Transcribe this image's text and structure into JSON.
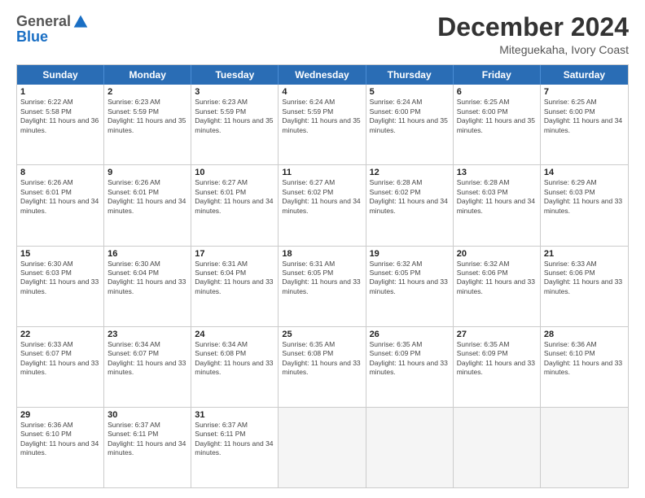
{
  "logo": {
    "general": "General",
    "blue": "Blue"
  },
  "header": {
    "month": "December 2024",
    "location": "Miteguekaha, Ivory Coast"
  },
  "days": [
    "Sunday",
    "Monday",
    "Tuesday",
    "Wednesday",
    "Thursday",
    "Friday",
    "Saturday"
  ],
  "weeks": [
    [
      {
        "day": "1",
        "sunrise": "6:22 AM",
        "sunset": "5:58 PM",
        "daylight": "11 hours and 36 minutes."
      },
      {
        "day": "2",
        "sunrise": "6:23 AM",
        "sunset": "5:59 PM",
        "daylight": "11 hours and 35 minutes."
      },
      {
        "day": "3",
        "sunrise": "6:23 AM",
        "sunset": "5:59 PM",
        "daylight": "11 hours and 35 minutes."
      },
      {
        "day": "4",
        "sunrise": "6:24 AM",
        "sunset": "5:59 PM",
        "daylight": "11 hours and 35 minutes."
      },
      {
        "day": "5",
        "sunrise": "6:24 AM",
        "sunset": "6:00 PM",
        "daylight": "11 hours and 35 minutes."
      },
      {
        "day": "6",
        "sunrise": "6:25 AM",
        "sunset": "6:00 PM",
        "daylight": "11 hours and 35 minutes."
      },
      {
        "day": "7",
        "sunrise": "6:25 AM",
        "sunset": "6:00 PM",
        "daylight": "11 hours and 34 minutes."
      }
    ],
    [
      {
        "day": "8",
        "sunrise": "6:26 AM",
        "sunset": "6:01 PM",
        "daylight": "11 hours and 34 minutes."
      },
      {
        "day": "9",
        "sunrise": "6:26 AM",
        "sunset": "6:01 PM",
        "daylight": "11 hours and 34 minutes."
      },
      {
        "day": "10",
        "sunrise": "6:27 AM",
        "sunset": "6:01 PM",
        "daylight": "11 hours and 34 minutes."
      },
      {
        "day": "11",
        "sunrise": "6:27 AM",
        "sunset": "6:02 PM",
        "daylight": "11 hours and 34 minutes."
      },
      {
        "day": "12",
        "sunrise": "6:28 AM",
        "sunset": "6:02 PM",
        "daylight": "11 hours and 34 minutes."
      },
      {
        "day": "13",
        "sunrise": "6:28 AM",
        "sunset": "6:03 PM",
        "daylight": "11 hours and 34 minutes."
      },
      {
        "day": "14",
        "sunrise": "6:29 AM",
        "sunset": "6:03 PM",
        "daylight": "11 hours and 33 minutes."
      }
    ],
    [
      {
        "day": "15",
        "sunrise": "6:30 AM",
        "sunset": "6:03 PM",
        "daylight": "11 hours and 33 minutes."
      },
      {
        "day": "16",
        "sunrise": "6:30 AM",
        "sunset": "6:04 PM",
        "daylight": "11 hours and 33 minutes."
      },
      {
        "day": "17",
        "sunrise": "6:31 AM",
        "sunset": "6:04 PM",
        "daylight": "11 hours and 33 minutes."
      },
      {
        "day": "18",
        "sunrise": "6:31 AM",
        "sunset": "6:05 PM",
        "daylight": "11 hours and 33 minutes."
      },
      {
        "day": "19",
        "sunrise": "6:32 AM",
        "sunset": "6:05 PM",
        "daylight": "11 hours and 33 minutes."
      },
      {
        "day": "20",
        "sunrise": "6:32 AM",
        "sunset": "6:06 PM",
        "daylight": "11 hours and 33 minutes."
      },
      {
        "day": "21",
        "sunrise": "6:33 AM",
        "sunset": "6:06 PM",
        "daylight": "11 hours and 33 minutes."
      }
    ],
    [
      {
        "day": "22",
        "sunrise": "6:33 AM",
        "sunset": "6:07 PM",
        "daylight": "11 hours and 33 minutes."
      },
      {
        "day": "23",
        "sunrise": "6:34 AM",
        "sunset": "6:07 PM",
        "daylight": "11 hours and 33 minutes."
      },
      {
        "day": "24",
        "sunrise": "6:34 AM",
        "sunset": "6:08 PM",
        "daylight": "11 hours and 33 minutes."
      },
      {
        "day": "25",
        "sunrise": "6:35 AM",
        "sunset": "6:08 PM",
        "daylight": "11 hours and 33 minutes."
      },
      {
        "day": "26",
        "sunrise": "6:35 AM",
        "sunset": "6:09 PM",
        "daylight": "11 hours and 33 minutes."
      },
      {
        "day": "27",
        "sunrise": "6:35 AM",
        "sunset": "6:09 PM",
        "daylight": "11 hours and 33 minutes."
      },
      {
        "day": "28",
        "sunrise": "6:36 AM",
        "sunset": "6:10 PM",
        "daylight": "11 hours and 33 minutes."
      }
    ],
    [
      {
        "day": "29",
        "sunrise": "6:36 AM",
        "sunset": "6:10 PM",
        "daylight": "11 hours and 34 minutes."
      },
      {
        "day": "30",
        "sunrise": "6:37 AM",
        "sunset": "6:11 PM",
        "daylight": "11 hours and 34 minutes."
      },
      {
        "day": "31",
        "sunrise": "6:37 AM",
        "sunset": "6:11 PM",
        "daylight": "11 hours and 34 minutes."
      },
      null,
      null,
      null,
      null
    ]
  ]
}
